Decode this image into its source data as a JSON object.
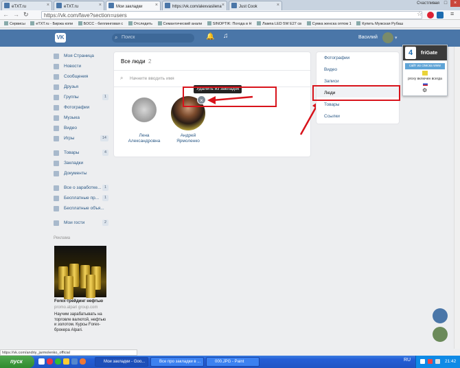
{
  "browser": {
    "tabs": [
      {
        "label": "eTXT.ru"
      },
      {
        "label": "eTXT.ru"
      },
      {
        "label": "Мои закладки"
      },
      {
        "label": "https://vk.com/alexvasilena"
      },
      {
        "label": "Just Cook"
      }
    ],
    "window_user": "Счастливая",
    "url": "https://vk.com/fave?section=users",
    "url_domain": "vk.com",
    "bookmarks": [
      "Сервисы",
      "eTXT.ru - Биржа копи",
      "БОСС - биллинговая с",
      "Отследить",
      "Семантический анали",
      "SINOPTIK: Погода в Н",
      "Лампа LED 5W E27 св",
      "Сумка женска оптом 1",
      "Купить Мужская Рубаш"
    ]
  },
  "vk_header": {
    "logo": "VK",
    "search_placeholder": "Поиск",
    "user_name": "Василий"
  },
  "sidebar": {
    "items": [
      {
        "label": "Моя Страница",
        "count": ""
      },
      {
        "label": "Новости",
        "count": ""
      },
      {
        "label": "Сообщения",
        "count": ""
      },
      {
        "label": "Друзья",
        "count": ""
      },
      {
        "label": "Группы",
        "count": "1"
      },
      {
        "label": "Фотографии",
        "count": ""
      },
      {
        "label": "Музыка",
        "count": ""
      },
      {
        "label": "Видео",
        "count": ""
      },
      {
        "label": "Игры",
        "count": "14"
      }
    ],
    "items2": [
      {
        "label": "Товары",
        "count": "4"
      },
      {
        "label": "Закладки",
        "count": ""
      },
      {
        "label": "Документы",
        "count": ""
      }
    ],
    "items3": [
      {
        "label": "Все о заработке...",
        "count": "1"
      },
      {
        "label": "Бесплатные пр...",
        "count": "1"
      },
      {
        "label": "Бесплатные объя...",
        "count": ""
      }
    ],
    "items4": [
      {
        "label": "Мои гости",
        "count": "2"
      }
    ],
    "ad_label": "Реклама",
    "ad_title": "Forex-трейдинг нефтью",
    "ad_url": "promo.alpari group.com",
    "ad_text": "Научим зарабатывать на торговле валютой, нефтью и золотом. Курсы Forex-брокера Alpari."
  },
  "main": {
    "title": "Все люди",
    "count": "2",
    "search_placeholder": "Начните вводить имя",
    "people": [
      {
        "name_line1": "Лена",
        "name_line2": "Александровна"
      },
      {
        "name_line1": "Андрей",
        "name_line2": "Ярмоленко"
      }
    ],
    "tooltip": "Удалить из закладок",
    "delete_symbol": "×"
  },
  "right_menu": {
    "items": [
      "Фотографии",
      "Видео",
      "Записи",
      "Люди",
      "Товары",
      "Ссылки"
    ],
    "selected": "Люди"
  },
  "frigate": {
    "name": "friGate",
    "status": "сайт из списка www",
    "proxy": "proxy включен всегда"
  },
  "status_url": "https://vk.com/andriy_jarmolenko_official",
  "taskbar": {
    "start": "пуск",
    "items": [
      "Мои закладки - Goo...",
      "Все про закладки в ...",
      "000.JPG - Paint"
    ],
    "lang": "RU",
    "time": "21:42"
  },
  "colors": {
    "vk_blue": "#4a76a8",
    "annotation_red": "#d8121a"
  }
}
